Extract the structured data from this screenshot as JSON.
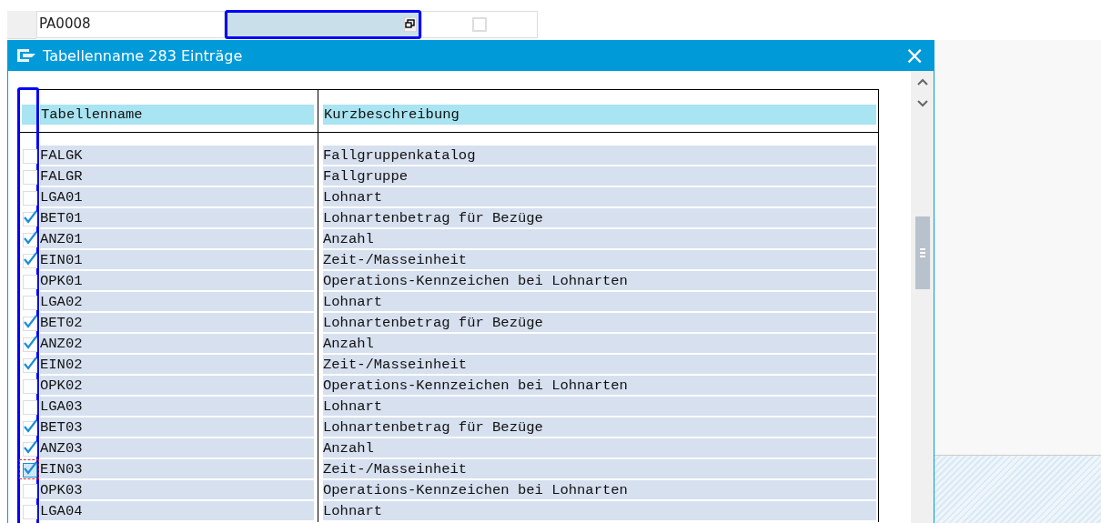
{
  "top_row": {
    "field_value": "PA0008",
    "checkbox": {
      "checked": false
    }
  },
  "dialog": {
    "title": "Tabellenname 283 Einträge",
    "close": "×",
    "table": {
      "columns": [
        "Tabellenname",
        "Kurzbeschreibung"
      ],
      "rows": [
        {
          "checked": false,
          "focused": false,
          "name": "FALGK",
          "description": "Fallgruppenkatalog"
        },
        {
          "checked": false,
          "focused": false,
          "name": "FALGR",
          "description": "Fallgruppe"
        },
        {
          "checked": false,
          "focused": false,
          "name": "LGA01",
          "description": "Lohnart"
        },
        {
          "checked": true,
          "focused": false,
          "name": "BET01",
          "description": "Lohnartenbetrag für Bezüge"
        },
        {
          "checked": true,
          "focused": false,
          "name": "ANZ01",
          "description": "Anzahl"
        },
        {
          "checked": true,
          "focused": false,
          "name": "EIN01",
          "description": "Zeit-/Masseinheit"
        },
        {
          "checked": false,
          "focused": false,
          "name": "OPK01",
          "description": "Operations-Kennzeichen bei Lohnarten"
        },
        {
          "checked": false,
          "focused": false,
          "name": "LGA02",
          "description": "Lohnart"
        },
        {
          "checked": true,
          "focused": false,
          "name": "BET02",
          "description": "Lohnartenbetrag für Bezüge"
        },
        {
          "checked": true,
          "focused": false,
          "name": "ANZ02",
          "description": "Anzahl"
        },
        {
          "checked": true,
          "focused": false,
          "name": "EIN02",
          "description": "Zeit-/Masseinheit"
        },
        {
          "checked": false,
          "focused": false,
          "name": "OPK02",
          "description": "Operations-Kennzeichen bei Lohnarten"
        },
        {
          "checked": false,
          "focused": false,
          "name": "LGA03",
          "description": "Lohnart"
        },
        {
          "checked": true,
          "focused": false,
          "name": "BET03",
          "description": "Lohnartenbetrag für Bezüge"
        },
        {
          "checked": true,
          "focused": false,
          "name": "ANZ03",
          "description": "Anzahl"
        },
        {
          "checked": true,
          "focused": true,
          "name": "EIN03",
          "description": "Zeit-/Masseinheit"
        },
        {
          "checked": false,
          "focused": false,
          "name": "OPK03",
          "description": "Operations-Kennzeichen bei Lohnarten"
        },
        {
          "checked": false,
          "focused": false,
          "name": "LGA04",
          "description": "Lohnart"
        }
      ]
    }
  }
}
